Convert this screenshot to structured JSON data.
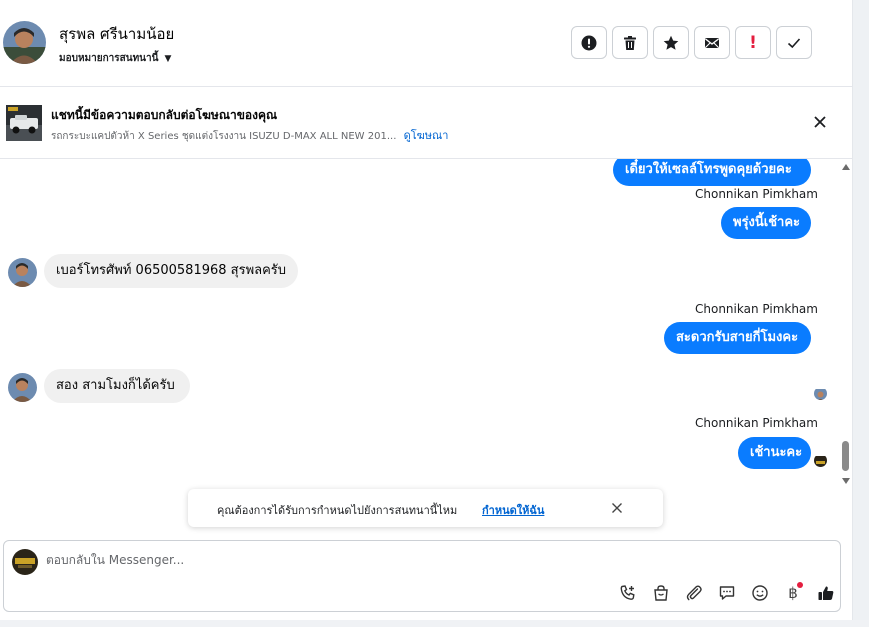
{
  "header": {
    "contact_name": "สุรพล ศรีนามน้อย",
    "assign_label": "มอบหมายการสนทนานี้",
    "actions": [
      {
        "name": "spam-button",
        "icon": "alert-circle-icon"
      },
      {
        "name": "delete-button",
        "icon": "trash-icon"
      },
      {
        "name": "star-button",
        "icon": "star-icon"
      },
      {
        "name": "mark-unread-button",
        "icon": "envelope-icon"
      },
      {
        "name": "follow-up-button",
        "icon": "exclamation-icon"
      },
      {
        "name": "done-button",
        "icon": "checkmark-icon"
      }
    ]
  },
  "ad_banner": {
    "title": "แชทนี้มีข้อความตอบกลับต่อโฆษณาของคุณ",
    "subtitle": "รถกระบะแคปตัวห้า X Series ชุดแต่งโรงงาน ISUZU D-MAX ALL NEW 201...",
    "link": "ดูโฆษณา"
  },
  "messages": {
    "m1": "เดี๋ยวให้เซลล์โทรพูดคุยด้วยคะ",
    "sender2": "Chonnikan Pimkham",
    "m2": "พรุ่งนี้เช้าคะ",
    "m3": "เบอร์โทรศัพท์ 06500581968 สุรพลครับ",
    "sender4": "Chonnikan Pimkham",
    "m4": "สะดวกรับสายกี่โมงคะ",
    "m5": "สอง สามโมงก็ได้ครับ",
    "sender6": "Chonnikan Pimkham",
    "m6": "เช้านะคะ"
  },
  "reminder": {
    "text": "คุณต้องการได้รับการกำหนดไปยังการสนทนานี้ไหม",
    "link": "กำหนดให้ฉัน"
  },
  "composer": {
    "placeholder": "ตอบกลับใน Messenger...",
    "value": "",
    "tools": [
      "call-add-icon",
      "shopping-bag-icon",
      "paperclip-icon",
      "chat-bubble-icon",
      "emoji-icon",
      "baht-icon",
      "thumbs-up-icon"
    ]
  },
  "colors": {
    "accent": "#0a7cff",
    "link": "#0064d1",
    "incoming_bubble": "#f0f0f0",
    "alert_red": "#e41e3f"
  }
}
